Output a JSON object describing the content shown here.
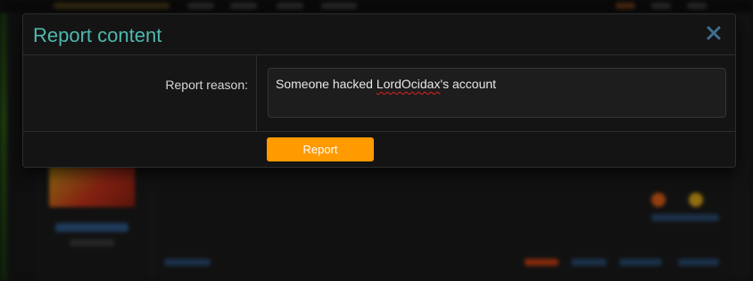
{
  "modal": {
    "title": "Report content",
    "close_icon": "close-icon",
    "reason_label": "Report reason:",
    "reason_value_prefix": "Someone hacked ",
    "reason_value_misspelled": "LordOcidax",
    "reason_value_suffix": "'s account",
    "submit_label": "Report"
  },
  "colors": {
    "title": "#4fb8ae",
    "button": "#ff9a00",
    "close_icon": "#3f6f8f"
  }
}
